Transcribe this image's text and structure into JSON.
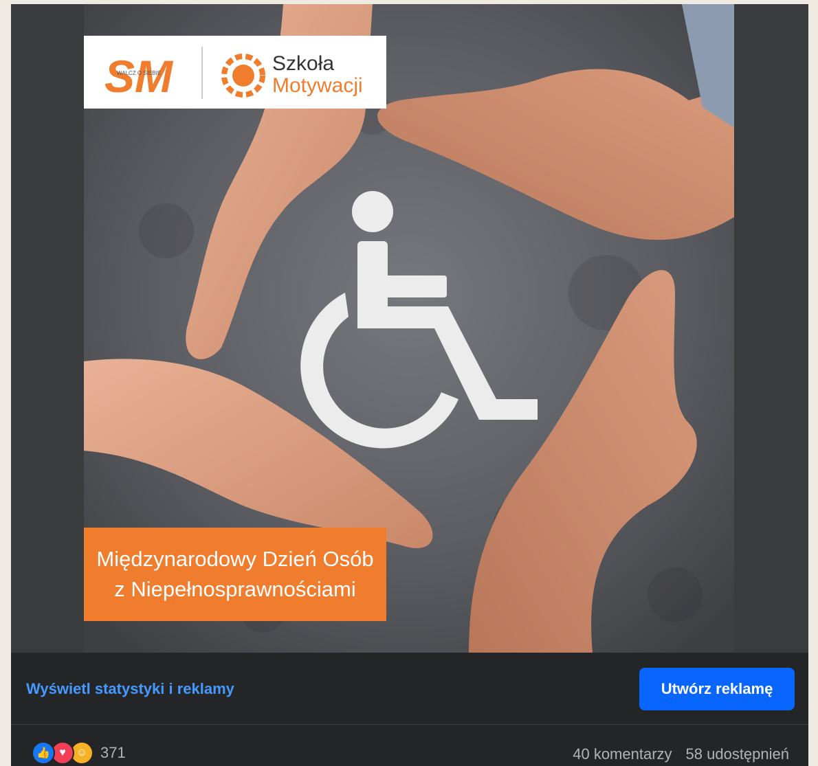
{
  "post": {
    "logo": {
      "sm": "SM",
      "tagline": "WALCZ O SIEBIE",
      "school_line1": "Szkoła",
      "school_line2": "Motywacji"
    },
    "banner": {
      "line1": "Międzynarodowy Dzień Osób",
      "line2": "z Niepełnosprawnościami"
    },
    "colors": {
      "accent": "#ef7d2d",
      "link": "#4599ff",
      "button": "#0866ff"
    }
  },
  "actions": {
    "stats_link": "Wyświetl statystyki i reklamy",
    "create_ad": "Utwórz reklamę"
  },
  "footer": {
    "reaction_icons": [
      "like-icon",
      "love-icon",
      "care-icon"
    ],
    "reaction_count": "371",
    "comments": "40 komentarzy",
    "shares": "58 udostępnień"
  }
}
